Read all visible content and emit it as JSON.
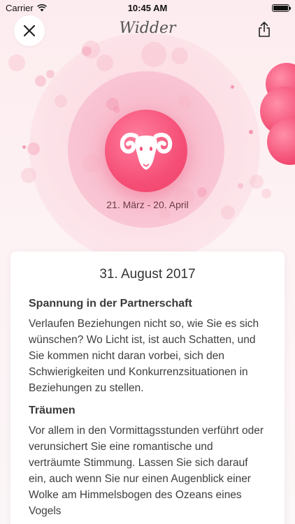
{
  "status_bar": {
    "carrier": "Carrier",
    "time": "10:45 AM"
  },
  "header": {
    "title": "Widder"
  },
  "hero": {
    "sign_icon": "ram-icon",
    "date_range": "21. März - 20. April"
  },
  "horoscope": {
    "date": "31. August 2017",
    "sections": [
      {
        "title": "Spannung in der Partnerschaft",
        "body": "Verlaufen Beziehungen nicht so, wie Sie es sich wünschen? Wo Licht ist, ist auch Schatten, und Sie kommen nicht daran vorbei, sich den Schwierigkeiten und Konkurrenzsituationen in Beziehungen zu stellen."
      },
      {
        "title": "Träumen",
        "body": "Vor allem in den Vormittagsstunden verführt oder verunsichert Sie eine romantische und verträumte Stimmung. Lassen Sie sich darauf ein, auch wenn Sie nur einen Augenblick einer Wolke am Himmelsbogen des Ozeans eines Vogels"
      }
    ]
  },
  "colors": {
    "accent": "#f54f77",
    "background": "#fdf2f4"
  }
}
